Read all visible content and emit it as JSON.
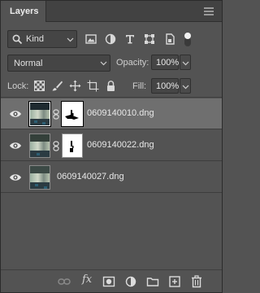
{
  "panel": {
    "tab_label": "Layers"
  },
  "filter": {
    "kind_label": "Kind",
    "icons": [
      "pixel-filter-icon",
      "adjustment-filter-icon",
      "type-filter-icon",
      "shape-filter-icon",
      "smart-object-filter-icon",
      "filter-toggle-icon"
    ]
  },
  "blend": {
    "mode": "Normal",
    "opacity_label": "Opacity:",
    "opacity_value": "100%"
  },
  "lock": {
    "label": "Lock:",
    "icons": [
      "lock-transparent-pixels-icon",
      "lock-image-pixels-icon",
      "lock-position-icon",
      "lock-artboard-icon",
      "lock-all-icon"
    ],
    "fill_label": "Fill:",
    "fill_value": "100%"
  },
  "layers": [
    {
      "name": "0609140010.dng",
      "visible": true,
      "has_mask": true,
      "selected": true
    },
    {
      "name": "0609140022.dng",
      "visible": true,
      "has_mask": true,
      "selected": false
    },
    {
      "name": "0609140027.dng",
      "visible": true,
      "has_mask": false,
      "selected": false
    }
  ],
  "toolbar": {
    "fx_label": "fx",
    "icons": [
      "link-layers-icon",
      "layer-style-icon",
      "add-mask-icon",
      "adjustment-layer-icon",
      "new-group-icon",
      "new-layer-icon",
      "delete-layer-icon"
    ]
  },
  "colors": {
    "panel_bg": "#535353",
    "selected_row": "#6f6f6f",
    "field_bg": "#454545"
  }
}
